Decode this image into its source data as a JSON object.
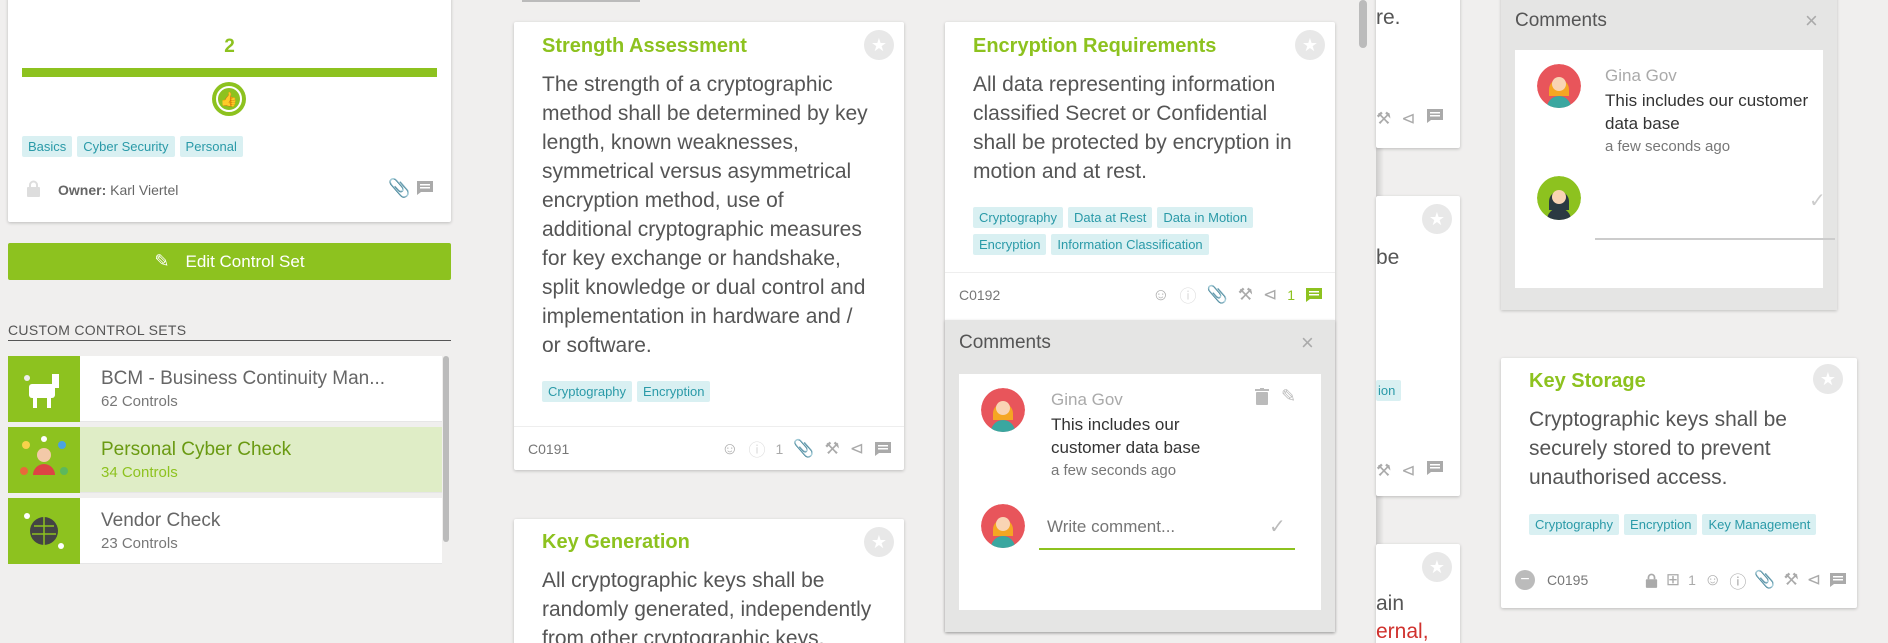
{
  "left_panel": {
    "count": "2",
    "tags": [
      "Basics",
      "Cyber Security",
      "Personal"
    ],
    "owner_label": "Owner:",
    "owner_name": "Karl Viertel",
    "edit_button": "Edit Control Set",
    "section_title": "CUSTOM CONTROL SETS",
    "sets": [
      {
        "name": "BCM - Business Continuity Man...",
        "count": "62 Controls"
      },
      {
        "name": "Personal Cyber Check",
        "count": "34 Controls"
      },
      {
        "name": "Vendor Check",
        "count": "23 Controls"
      }
    ]
  },
  "cards": {
    "strength": {
      "title": "Strength Assessment",
      "lines": [
        "The strength of a cryptographic",
        "method shall be determined by key",
        "length, known weaknesses,",
        "symmetrical versus asymmetrical",
        "encryption method, use of",
        "additional cryptographic measures",
        "for key exchange or handshake,",
        "split knowledge or dual control and",
        "implementation in hardware and /",
        "or software."
      ],
      "tags": [
        "Cryptography",
        "Encryption"
      ],
      "id": "C0191",
      "attach_count": "1"
    },
    "keygen": {
      "title": "Key Generation",
      "lines": [
        "All cryptographic keys shall be",
        "randomly generated, independently",
        "from other cryptographic keys."
      ]
    },
    "encryption": {
      "title": "Encryption Requirements",
      "lines": [
        "All data representing information",
        "classified Secret or Confidential",
        "shall be protected by encryption in",
        "motion and at rest."
      ],
      "tags": [
        "Cryptography",
        "Data at Rest",
        "Data in Motion",
        "Encryption",
        "Information Classification"
      ],
      "id": "C0192",
      "comment_count": "1"
    },
    "keystorage": {
      "title": "Key Storage",
      "lines": [
        "Cryptographic keys shall be",
        "securely stored to prevent",
        "unauthorised access."
      ],
      "tags": [
        "Cryptography",
        "Encryption",
        "Key Management"
      ],
      "id": "C0195",
      "attach_count": "1"
    },
    "partial": {
      "frag1": "re.",
      "frag2": "be",
      "tag_frag": "ion",
      "frag3": "ain",
      "frag4": "ernal,"
    }
  },
  "comments_mid": {
    "header": "Comments",
    "author": "Gina Gov",
    "text_lines": [
      "This includes our",
      "customer data base"
    ],
    "time": "a few seconds ago",
    "placeholder": "Write comment..."
  },
  "comments_right": {
    "header": "Comments",
    "author": "Gina Gov",
    "text_lines": [
      "This includes our customer",
      "data base"
    ],
    "time": "a few seconds ago"
  },
  "colors": {
    "accent": "#8dc21f",
    "tag_bg": "#d9f0f2",
    "tag_text": "#2a9aa8",
    "danger": "#d0312d"
  }
}
